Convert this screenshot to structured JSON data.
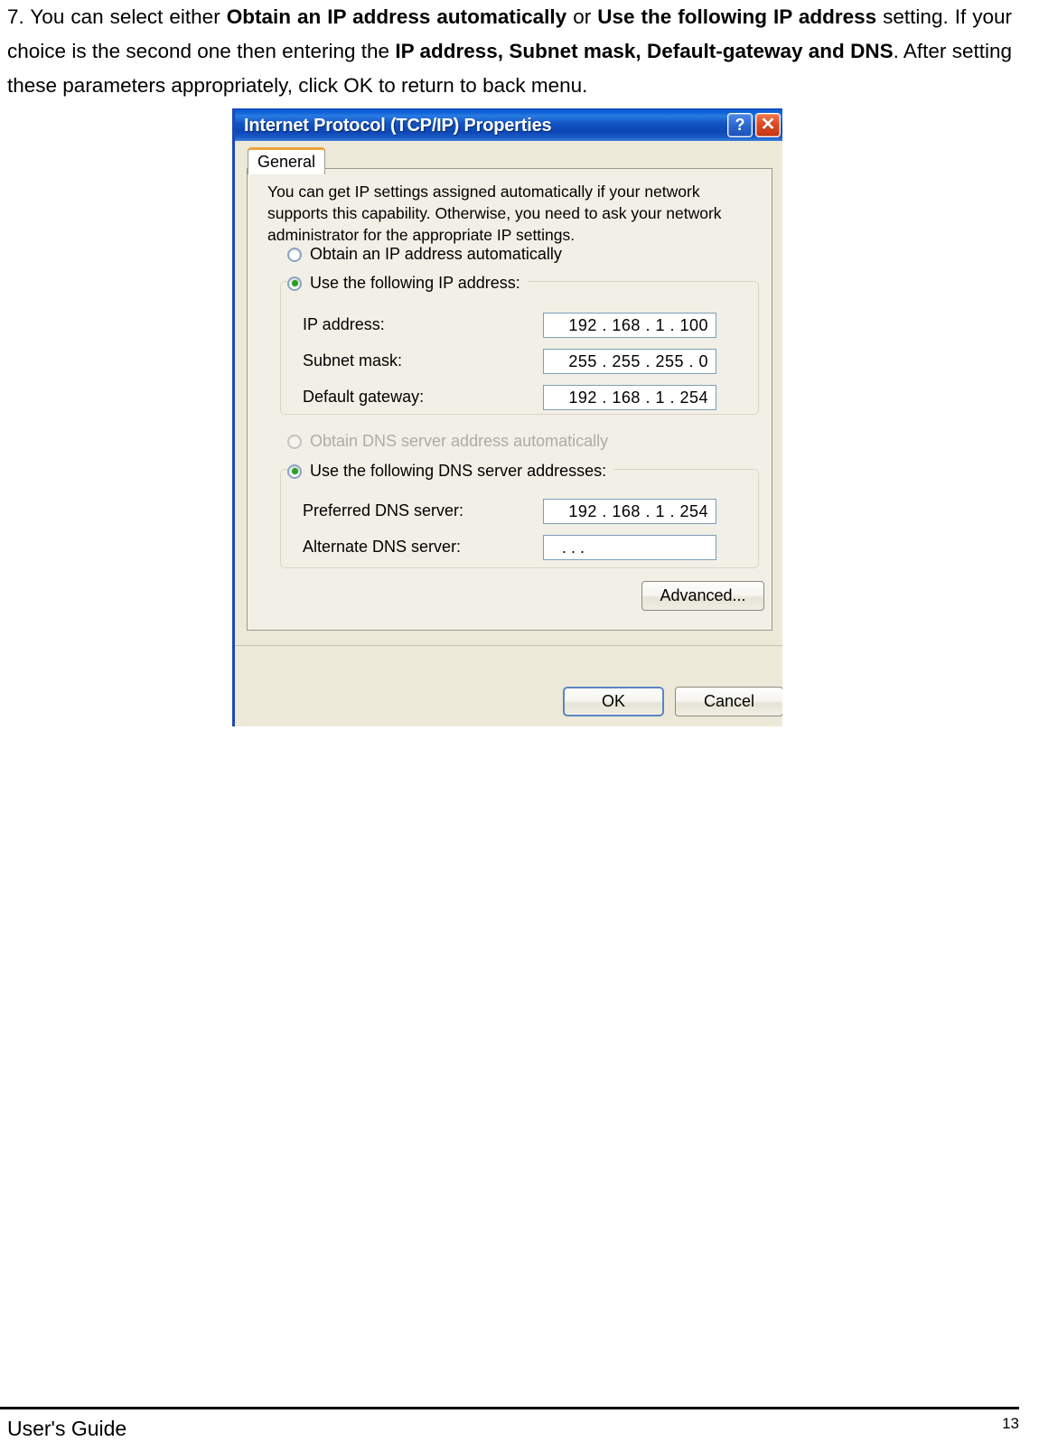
{
  "document": {
    "paragraph": {
      "prefix": "7. You can select either ",
      "bold1": "Obtain an IP address automatically",
      "mid1": " or ",
      "bold2": "Use the following IP address",
      "mid2": " setting. If your choice is the second one then entering the ",
      "bold3": "IP address, Subnet mask, Default-gateway and DNS",
      "suffix": ". After setting these parameters appropriately, click OK to return to back menu."
    },
    "footer": {
      "left_label": "User's Guide",
      "page_number": "13"
    }
  },
  "dialog": {
    "title": "Internet Protocol (TCP/IP) Properties",
    "titlebar_buttons": {
      "help": "?",
      "close": "✕"
    },
    "tabs": [
      {
        "label": "General",
        "selected": true
      }
    ],
    "description": "You can get IP settings assigned automatically if your network supports this capability. Otherwise, you need to ask your network administrator for the appropriate IP settings.",
    "ip_section": {
      "radio_auto_label": "Obtain an IP address automatically",
      "radio_auto_selected": false,
      "radio_manual_label": "Use the following IP address:",
      "radio_manual_selected": true,
      "fields": [
        {
          "label": "IP address:",
          "value": "192 . 168 .  1   . 100"
        },
        {
          "label": "Subnet mask:",
          "value": "255 . 255 . 255 .   0"
        },
        {
          "label": "Default gateway:",
          "value": "192 . 168 .  1   . 254"
        }
      ]
    },
    "dns_section": {
      "radio_auto_label": "Obtain DNS server address automatically",
      "radio_auto_selected": false,
      "radio_auto_disabled": true,
      "radio_manual_label": "Use the following DNS server addresses:",
      "radio_manual_selected": true,
      "fields": [
        {
          "label": "Preferred DNS server:",
          "value": "192 . 168 .  1   . 254"
        },
        {
          "label": "Alternate DNS server:",
          "value": ".    .    ."
        }
      ]
    },
    "buttons": {
      "advanced": "Advanced...",
      "ok": "OK",
      "cancel": "Cancel"
    },
    "colors": {
      "titlebar_blue": "#1355c4",
      "close_red": "#e04a22",
      "dialog_face": "#ece9d8",
      "tab_accent_orange": "#f0a23c",
      "radio_dot_green": "#2aa124",
      "default_button_border": "#5a86c4"
    }
  }
}
